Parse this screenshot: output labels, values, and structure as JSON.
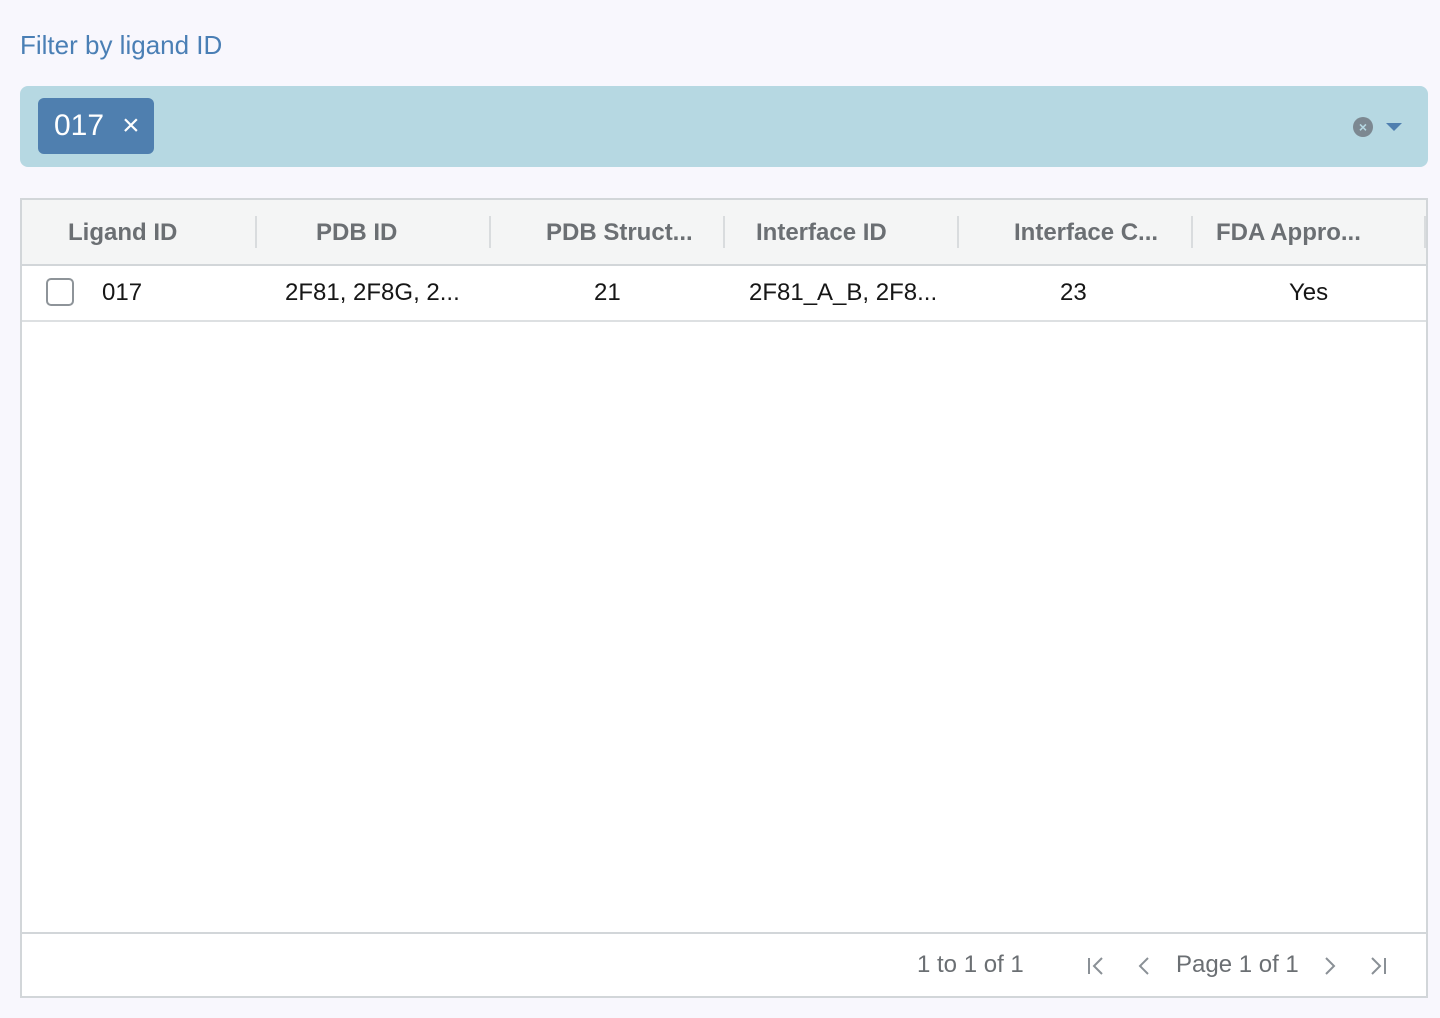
{
  "filter": {
    "label": "Filter by ligand ID",
    "chips": [
      {
        "label": "017",
        "remove_icon": "×"
      }
    ],
    "clear_icon": "×"
  },
  "grid": {
    "columns": [
      "Ligand ID",
      "PDB ID",
      "PDB Struct...",
      "Interface ID",
      "Interface C...",
      "FDA Appro..."
    ],
    "rows": [
      {
        "ligand_id": "017",
        "pdb_id": "2F81, 2F8G, 2...",
        "pdb_structures": "21",
        "interface_id": "2F81_A_B, 2F8...",
        "interface_count": "23",
        "fda_approved": "Yes"
      }
    ],
    "pagination": {
      "summary": "1 to 1 of 1",
      "page_info": "Page 1 of 1"
    }
  }
}
